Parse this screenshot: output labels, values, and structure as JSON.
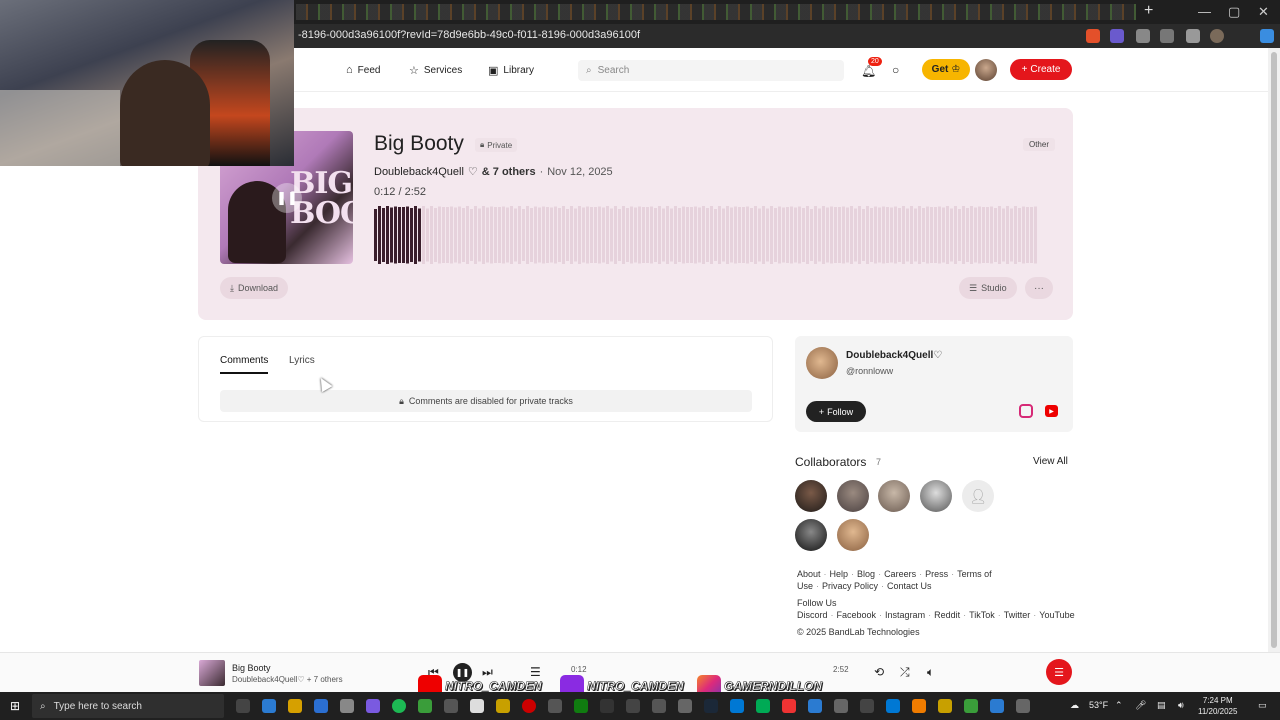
{
  "browser": {
    "url": "-8196-000d3a96100f?revId=78d9e6bb-49c0-f011-8196-000d3a96100f",
    "new_tab": "+",
    "minimize": "—",
    "maximize": "▢",
    "close": "✕"
  },
  "header": {
    "nav": [
      {
        "label": "Feed",
        "icon": "home-icon"
      },
      {
        "label": "Services",
        "icon": "star-icon"
      },
      {
        "label": "Library",
        "icon": "library-icon"
      }
    ],
    "search_placeholder": "Search",
    "notification_count": "20",
    "get_label": "Get",
    "create_label": "Create"
  },
  "track": {
    "title": "Big Booty",
    "privacy": "Private",
    "genre": "Other",
    "artist": "Doubleback4Quell",
    "others": "& 7 others",
    "date": "Nov 12, 2025",
    "time_current": "0:12",
    "time_total": "2:52",
    "progress_fraction": 0.07,
    "download_label": "Download",
    "studio_label": "Studio",
    "more_label": "···",
    "cover_text": "BIG BOOTY",
    "accent_color": "#e4161c"
  },
  "comments": {
    "tab_comments": "Comments",
    "tab_lyrics": "Lyrics",
    "disabled_text": "Comments are disabled for private tracks"
  },
  "artist_card": {
    "name": "Doubleback4Quell",
    "handle": "@ronnloww",
    "follow_label": "Follow"
  },
  "collaborators": {
    "title": "Collaborators",
    "count": "7",
    "view_all": "View All"
  },
  "footer": {
    "links1": [
      "About",
      "Help",
      "Blog",
      "Careers",
      "Press",
      "Terms of Use",
      "Privacy Policy",
      "Contact Us"
    ],
    "follow_us": "Follow Us",
    "links2": [
      "Discord",
      "Facebook",
      "Instagram",
      "Reddit",
      "TikTok",
      "Twitter",
      "YouTube"
    ],
    "copyright": "© 2025 BandLab Technologies"
  },
  "player": {
    "title": "Big Booty",
    "subtitle": "Doubleback4Quell♡ + 7 others",
    "time_current": "0:12",
    "time_total": "2:52"
  },
  "taskbar": {
    "search_placeholder": "Type here to search",
    "weather": "53°F",
    "time": "7:24 PM",
    "date": "11/20/2025"
  },
  "stream_overlay": {
    "youtube": "NITRO_CAMDEN",
    "twitch": "NITRO_CAMDEN",
    "instagram": "GAMERNDILLON"
  }
}
